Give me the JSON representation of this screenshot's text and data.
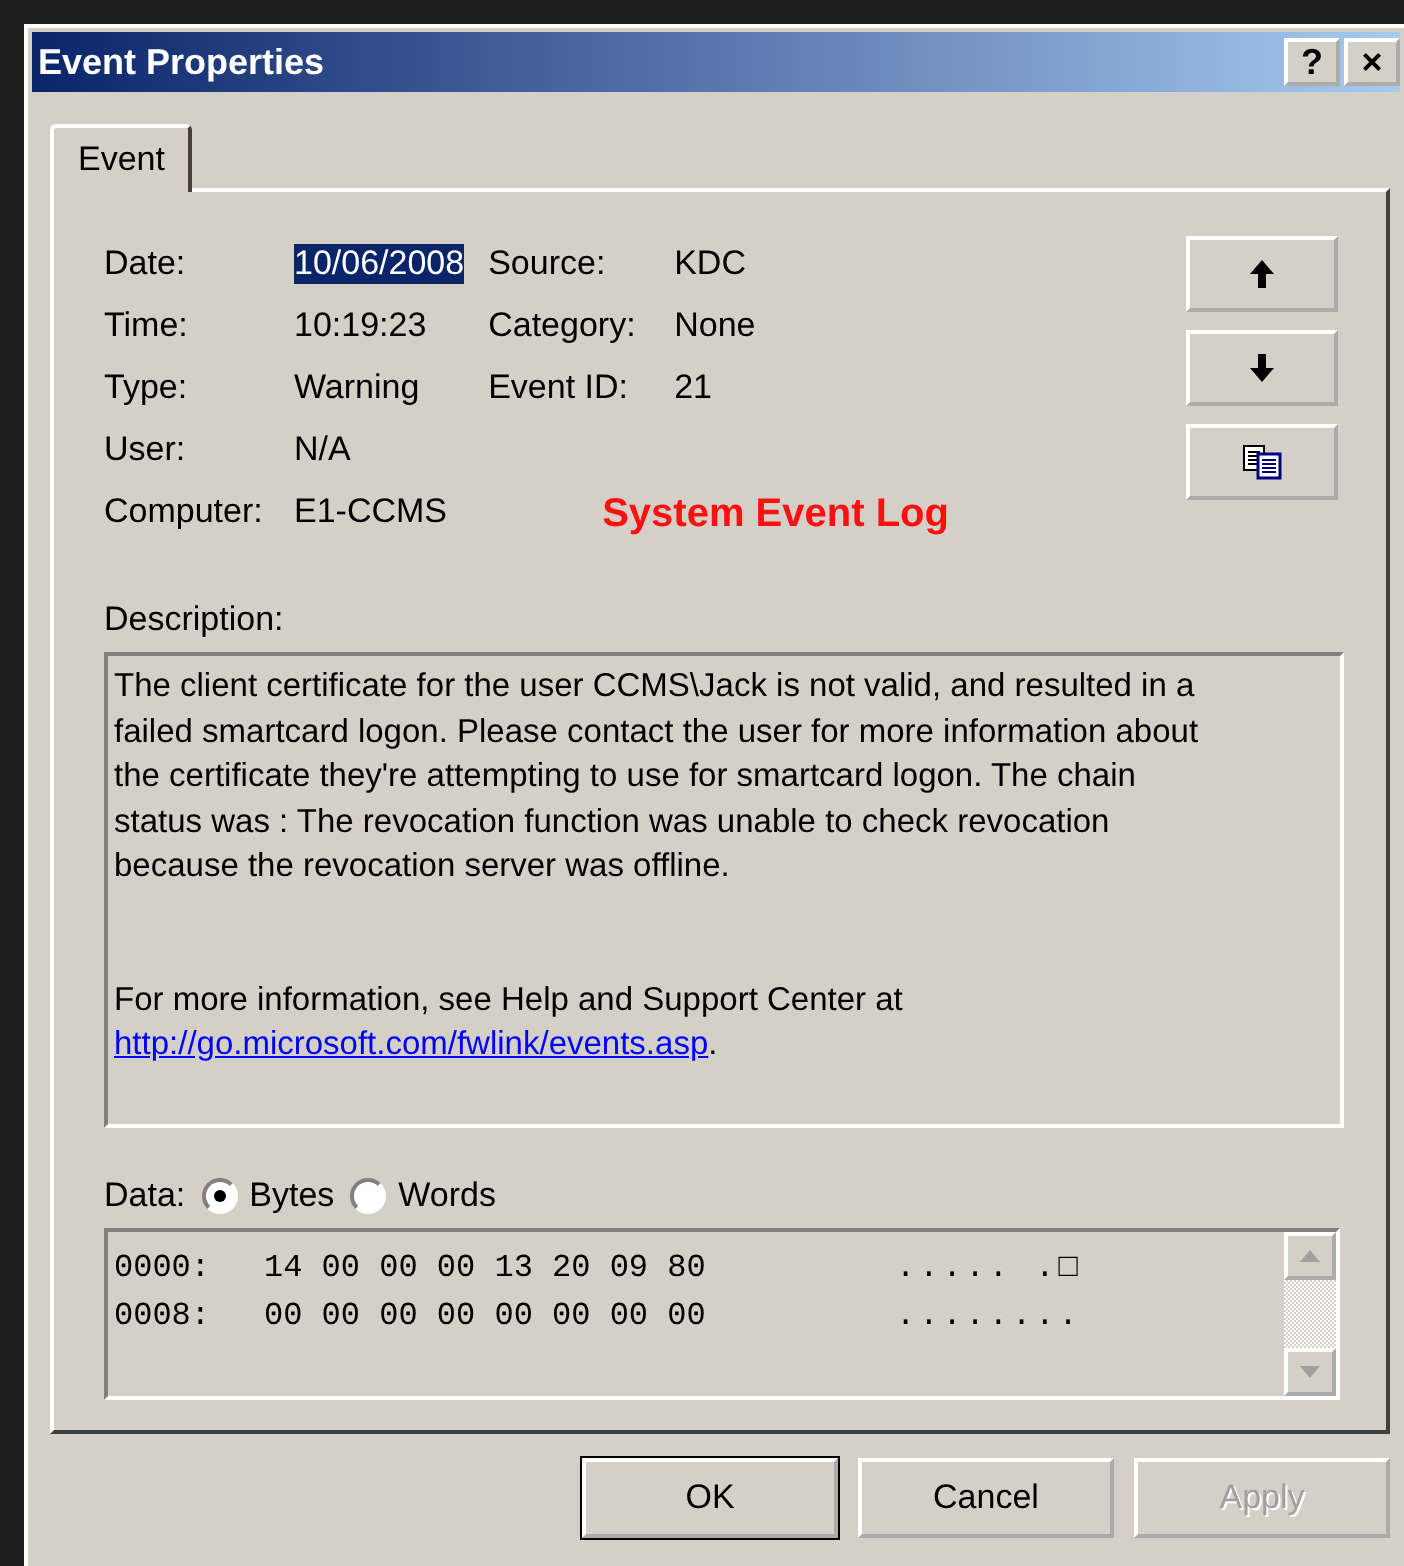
{
  "window": {
    "title": "Event Properties",
    "help_button": "?",
    "close_button": "×"
  },
  "tabs": [
    {
      "label": "Event",
      "selected": true
    }
  ],
  "fields_left": [
    {
      "label": "Date:",
      "value": "10/06/2008",
      "selected": true
    },
    {
      "label": "Time:",
      "value": "10:19:23",
      "selected": false
    },
    {
      "label": "Type:",
      "value": "Warning",
      "selected": false
    },
    {
      "label": "User:",
      "value": "N/A",
      "selected": false
    },
    {
      "label": "Computer:",
      "value": "E1-CCMS",
      "selected": false
    }
  ],
  "fields_right": [
    {
      "label": "Source:",
      "value": "KDC"
    },
    {
      "label": "Category:",
      "value": "None"
    },
    {
      "label": "Event ID:",
      "value": "21"
    }
  ],
  "overlay_label": "System Event Log",
  "description": {
    "label": "Description:",
    "paragraph": "The client certificate for the user CCMS\\Jack is not valid, and resulted in a\nfailed smartcard logon.  Please contact the user for more information about\nthe certificate they're attempting to use for smartcard logon. The chain\nstatus was : The revocation function was unable to check revocation\nbecause the revocation server was offline.",
    "more_info": "For more information, see Help and Support Center at",
    "link": "http://go.microsoft.com/fwlink/events.asp",
    "link_suffix": "."
  },
  "data": {
    "label": "Data:",
    "options": [
      {
        "label": "Bytes",
        "selected": true
      },
      {
        "label": "Words",
        "selected": false
      }
    ],
    "rows": [
      {
        "offset": "0000:",
        "bytes": "14 00 00 00 13 20 09 80",
        "chars": "..... .□"
      },
      {
        "offset": "0008:",
        "bytes": "00 00 00 00 00 00 00 00",
        "chars": "........"
      }
    ]
  },
  "buttons": [
    {
      "label": "OK",
      "default": true,
      "disabled": false
    },
    {
      "label": "Cancel",
      "default": false,
      "disabled": false
    },
    {
      "label": "Apply",
      "default": false,
      "disabled": true
    }
  ]
}
